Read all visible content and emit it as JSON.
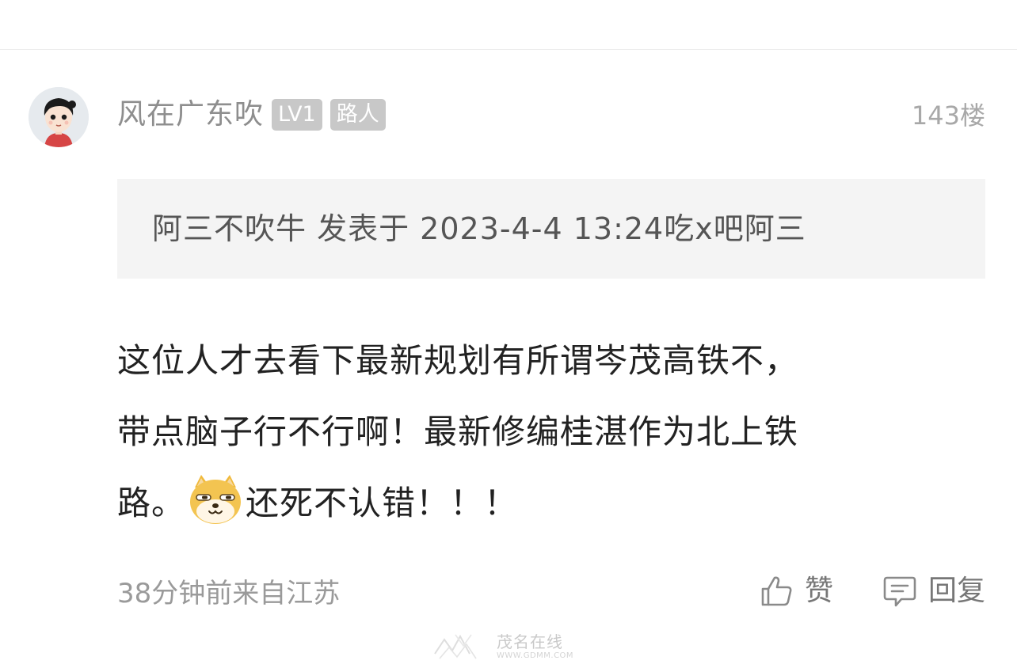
{
  "post": {
    "user": {
      "name": "风在广东吹",
      "level_badge": "LV1",
      "role_badge": "路人",
      "avatar_icon": "avatar-cartoon-boy"
    },
    "floor": "143楼",
    "quote": {
      "text": "阿三不吹牛 发表于 2023-4-4 13:24吃x吧阿三"
    },
    "content": {
      "line1": "这位人才去看下最新规划有所谓岑茂高铁不，",
      "line2": "带点脑子行不行啊！最新修编桂湛作为北上铁",
      "line3_before_emoji": "路。",
      "emoji": "doge-emoji",
      "line3_after_emoji": "还死不认错！！！"
    },
    "meta": "38分钟前来自江苏",
    "actions": {
      "like_label": "赞",
      "like_icon": "thumbs-up-icon",
      "reply_label": "回复",
      "reply_icon": "chat-bubble-icon"
    },
    "watermark": {
      "cn": "茂名在线",
      "en": "WWW.GDMM.COM"
    }
  },
  "colors": {
    "badge_bg": "#c8c8c8",
    "quote_bg": "#f4f4f4",
    "meta_text": "#9a9a9a",
    "divider": "#ececec"
  }
}
